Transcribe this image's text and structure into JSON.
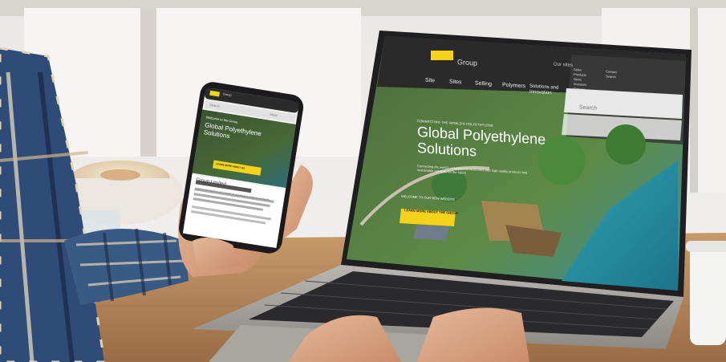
{
  "photo": {
    "laptop_site": {
      "brand_word": "Group",
      "top_right_link": "Our sites",
      "nav": [
        "Site",
        "Sites",
        "Selling",
        "Polymers",
        "Solutions and Innovation"
      ],
      "sidebar_items": [
        "Sales",
        "Products",
        "News",
        "Investors",
        "Careers"
      ],
      "sidebar_small_items": [
        "Contact",
        "Search"
      ],
      "search_label": "Search",
      "hero_kicker": "CONNECTING THE WORLD'S POLYETHYLENE",
      "hero_title_line1": "Global Polyethylene",
      "hero_title_line2": "Solutions",
      "hero_body": "Connecting the world's polyethylene customers with high quality products and sustainable solutions for the future.",
      "welcome_label": "WELCOME TO OUR NEW WEBSITE",
      "cta_label": "LEARN MORE ABOUT THE GROUP",
      "accent_yellow": "#f5d31a",
      "header_color": "#2a2a2a"
    },
    "phone_site": {
      "top_label": "Group",
      "search_placeholder": "Search",
      "menu_label": "Menu",
      "hero_kicker": "Welcome to the Group",
      "hero_title": "Global Polyethylene Solutions",
      "cta_label": "LEARN MORE ABOUT US",
      "section_title": "Group Limited",
      "section_body": "Leading manufacturer and supplier of polyethylene products worldwide."
    }
  }
}
